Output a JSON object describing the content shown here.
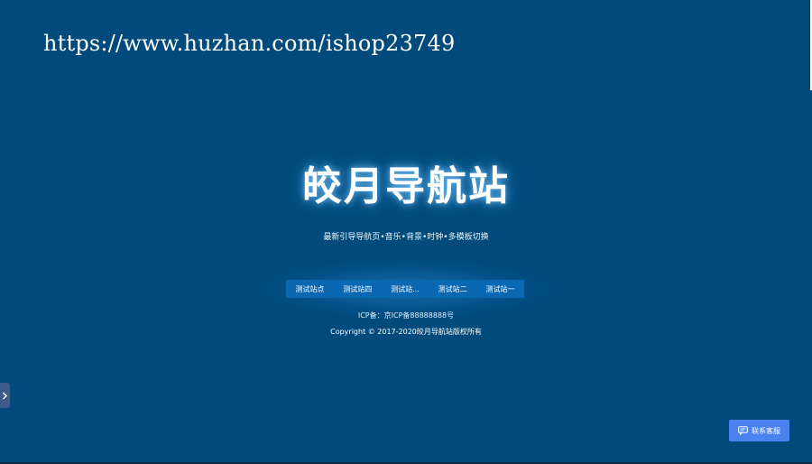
{
  "watermark": {
    "url": "https://www.huzhan.com/ishop23749"
  },
  "hero": {
    "title": "皎月导航站",
    "tagline": "最新引导导航页•音乐•背景•时钟•多模板切换"
  },
  "nav": {
    "links": [
      "测试站点",
      "测试站四",
      "测试站...",
      "测试站二",
      "测试站一"
    ]
  },
  "footer": {
    "icp": "ICP备：京ICP备88888888号",
    "copyright": "Copyright © 2017-2020皎月导航站版权所有"
  },
  "contact": {
    "label": "联系客服"
  },
  "icons": {
    "side_toggle": "chevron-right-icon",
    "contact": "chat-icon"
  },
  "colors": {
    "background": "#004b7b",
    "nav_bar": "#0a68b3",
    "contact_button": "#4a82f0",
    "side_toggle": "#3e5a8a"
  }
}
